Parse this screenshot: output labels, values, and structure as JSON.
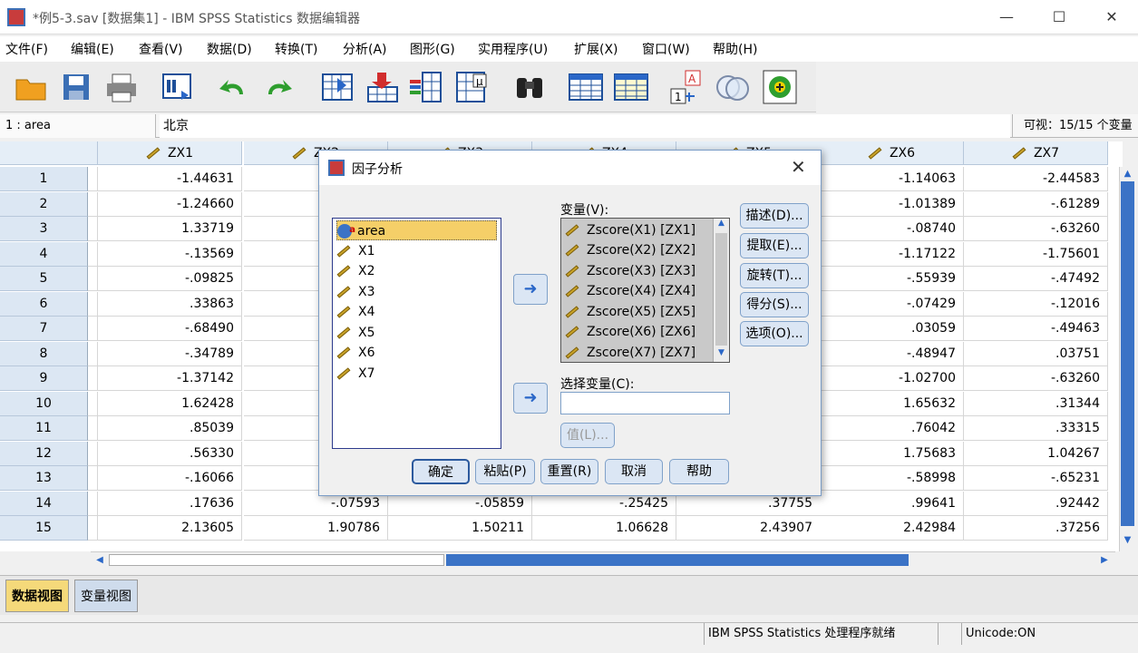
{
  "window": {
    "title": "*例5-3.sav [数据集1] - IBM SPSS Statistics 数据编辑器",
    "minimize": "—",
    "maximize": "☐",
    "close": "✕"
  },
  "menu": [
    "文件(F)",
    "编辑(E)",
    "查看(V)",
    "数据(D)",
    "转换(T)",
    "分析(A)",
    "图形(G)",
    "实用程序(U)",
    "扩展(X)",
    "窗口(W)",
    "帮助(H)"
  ],
  "toolbar": [
    "open-folder-icon",
    "save-icon",
    "print-icon",
    "recall-dialog-icon",
    "undo-icon",
    "redo-icon",
    "goto-case-icon",
    "insert-case-icon",
    "insert-variable-icon",
    "split-file-icon",
    "find-icon",
    "select-cases-icon",
    "weight-cases-icon",
    "value-labels-icon",
    "use-sets-icon",
    "show-all-icon"
  ],
  "cellbar": {
    "ref": "1 : area",
    "value": "北京",
    "visible": "可视：15/15 个变量"
  },
  "grid": {
    "columns": [
      "ZX1",
      "ZX2",
      "ZX3",
      "ZX4",
      "ZX5",
      "ZX6",
      "ZX7"
    ],
    "rows": [
      {
        "n": "1",
        "zx1": "-1.44631",
        "zx2": "",
        "zx3": "",
        "zx4": "",
        "zx5": "",
        "zx6": "-1.14063",
        "zx7": "-2.44583"
      },
      {
        "n": "2",
        "zx1": "-1.24660",
        "zx2": "",
        "zx3": "",
        "zx4": "",
        "zx5": "",
        "zx6": "-1.01389",
        "zx7": "-.61289"
      },
      {
        "n": "3",
        "zx1": "1.33719",
        "zx2": "",
        "zx3": "",
        "zx4": "",
        "zx5": "",
        "zx6": "-.08740",
        "zx7": "-.63260"
      },
      {
        "n": "4",
        "zx1": "-.13569",
        "zx2": "",
        "zx3": "",
        "zx4": "",
        "zx5": "",
        "zx6": "-1.17122",
        "zx7": "-1.75601"
      },
      {
        "n": "5",
        "zx1": "-.09825",
        "zx2": "",
        "zx3": "",
        "zx4": "",
        "zx5": "",
        "zx6": "-.55939",
        "zx7": "-.47492"
      },
      {
        "n": "6",
        "zx1": ".33863",
        "zx2": "",
        "zx3": "",
        "zx4": "",
        "zx5": "",
        "zx6": "-.07429",
        "zx7": "-.12016"
      },
      {
        "n": "7",
        "zx1": "-.68490",
        "zx2": "",
        "zx3": "",
        "zx4": "",
        "zx5": "",
        "zx6": ".03059",
        "zx7": "-.49463"
      },
      {
        "n": "8",
        "zx1": "-.34789",
        "zx2": "",
        "zx3": "",
        "zx4": "",
        "zx5": "",
        "zx6": "-.48947",
        "zx7": ".03751"
      },
      {
        "n": "9",
        "zx1": "-1.37142",
        "zx2": "",
        "zx3": "",
        "zx4": "",
        "zx5": "",
        "zx6": "-1.02700",
        "zx7": "-.63260"
      },
      {
        "n": "10",
        "zx1": "1.62428",
        "zx2": "",
        "zx3": "",
        "zx4": "",
        "zx5": "",
        "zx6": "1.65632",
        "zx7": ".31344"
      },
      {
        "n": "11",
        "zx1": ".85039",
        "zx2": "",
        "zx3": "",
        "zx4": "",
        "zx5": "",
        "zx6": ".76042",
        "zx7": ".33315"
      },
      {
        "n": "12",
        "zx1": ".56330",
        "zx2": "",
        "zx3": "",
        "zx4": "",
        "zx5": "",
        "zx6": "1.75683",
        "zx7": "1.04267"
      },
      {
        "n": "13",
        "zx1": "-.16066",
        "zx2": "",
        "zx3": "",
        "zx4": "",
        "zx5": "",
        "zx6": "-.58998",
        "zx7": "-.65231"
      },
      {
        "n": "14",
        "zx1": ".17636",
        "zx2": "-.07593",
        "zx3": "-.05859",
        "zx4": "-.25425",
        "zx5": ".37755",
        "zx6": ".99641",
        "zx7": ".92442"
      },
      {
        "n": "15",
        "zx1": "2.13605",
        "zx2": "1.90786",
        "zx3": "1.50211",
        "zx4": "1.06628",
        "zx5": "2.43907",
        "zx6": "2.42984",
        "zx7": ".37256"
      }
    ]
  },
  "tabs": {
    "data_view": "数据视图",
    "variable_view": "变量视图"
  },
  "status": {
    "processor": "IBM SPSS Statistics 处理程序就绪",
    "unicode": "Unicode:ON"
  },
  "dialog": {
    "title": "因子分析",
    "source_vars": [
      "area",
      "X1",
      "X2",
      "X3",
      "X4",
      "X5",
      "X6",
      "X7"
    ],
    "variables_label": "变量(V):",
    "variables": [
      "Zscore(X1) [ZX1]",
      "Zscore(X2) [ZX2]",
      "Zscore(X3) [ZX3]",
      "Zscore(X4) [ZX4]",
      "Zscore(X5) [ZX5]",
      "Zscore(X6) [ZX6]",
      "Zscore(X7) [ZX7]"
    ],
    "selection_label": "选择变量(C):",
    "value_button": "值(L)...",
    "side_buttons": [
      "描述(D)...",
      "提取(E)...",
      "旋转(T)...",
      "得分(S)...",
      "选项(O)..."
    ],
    "bottom_buttons": [
      "确定",
      "粘贴(P)",
      "重置(R)",
      "取消",
      "帮助"
    ]
  }
}
